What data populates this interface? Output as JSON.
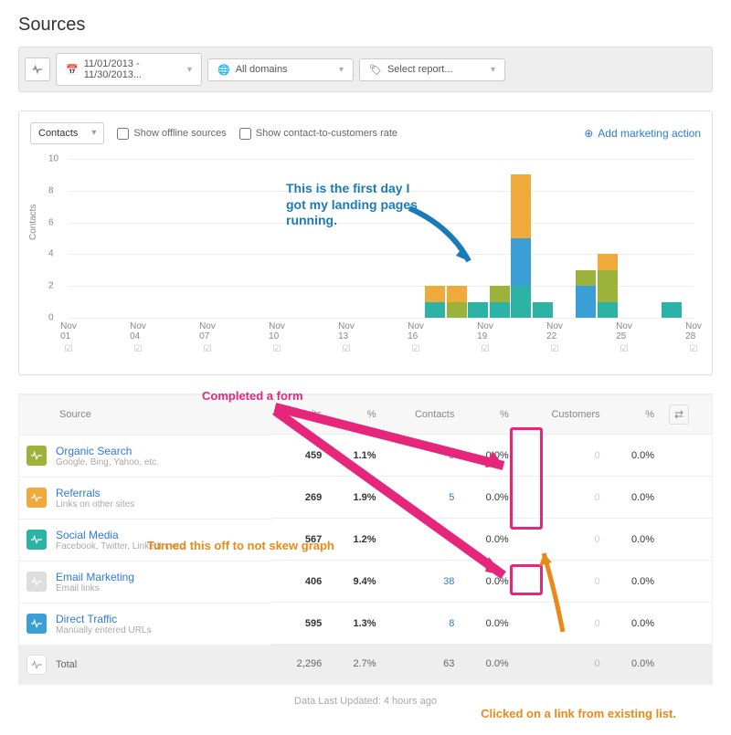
{
  "title": "Sources",
  "toolbar": {
    "date_range": "11/01/2013 - 11/30/2013...",
    "domains": "All domains",
    "report": "Select report..."
  },
  "panel": {
    "metric": "Contacts",
    "show_offline": "Show offline sources",
    "show_c2c": "Show contact-to-customers rate",
    "add_action": "Add marketing action"
  },
  "chart_data": {
    "type": "bar",
    "ylabel": "Contacts",
    "ylim": [
      0,
      10
    ],
    "yticks": [
      0,
      2,
      4,
      6,
      8,
      10
    ],
    "x_ticks": [
      "Nov\n01",
      "Nov\n04",
      "Nov\n07",
      "Nov\n10",
      "Nov\n13",
      "Nov\n16",
      "Nov\n19",
      "Nov\n22",
      "Nov\n25",
      "Nov\n28"
    ],
    "series_colors": {
      "a": "#2db3a5",
      "b": "#9bb23b",
      "c": "#f0a93b",
      "d": "#3b9fd6"
    },
    "stacks": {
      "18": [
        {
          "c": "a",
          "v": 1
        },
        {
          "c": "c",
          "v": 1
        }
      ],
      "19": [
        {
          "c": "b",
          "v": 1
        },
        {
          "c": "c",
          "v": 1
        }
      ],
      "20": [
        {
          "c": "a",
          "v": 1
        }
      ],
      "21": [
        {
          "c": "a",
          "v": 1
        },
        {
          "c": "b",
          "v": 1
        }
      ],
      "22": [
        {
          "c": "a",
          "v": 2
        },
        {
          "c": "d",
          "v": 3
        },
        {
          "c": "c",
          "v": 4
        }
      ],
      "23": [
        {
          "c": "a",
          "v": 1
        }
      ],
      "25": [
        {
          "c": "d",
          "v": 2
        },
        {
          "c": "b",
          "v": 1
        }
      ],
      "26": [
        {
          "c": "a",
          "v": 1
        },
        {
          "c": "b",
          "v": 2
        },
        {
          "c": "c",
          "v": 1
        }
      ],
      "29": [
        {
          "c": "a",
          "v": 1
        }
      ]
    }
  },
  "annotations": {
    "blue": "This is the first day I got my landing pages running.",
    "pink": "Completed a form",
    "orange1": "Turned this off to not skew graph",
    "orange2": "Clicked on a link from existing list."
  },
  "table": {
    "cols": [
      "Source",
      "Visits",
      "%",
      "Contacts",
      "%",
      "Customers",
      "%"
    ],
    "rows": [
      {
        "icon": "#9bb23b",
        "name": "Organic Search",
        "sub": "Google, Bing, Yahoo, etc.",
        "visits": "459",
        "vp": "1.1%",
        "contacts": "5",
        "cp": "0.0%",
        "cust": "0",
        "cup": "0.0%"
      },
      {
        "icon": "#f0a93b",
        "name": "Referrals",
        "sub": "Links on other sites",
        "visits": "269",
        "vp": "1.9%",
        "contacts": "5",
        "cp": "0.0%",
        "cust": "0",
        "cup": "0.0%"
      },
      {
        "icon": "#2db3a5",
        "name": "Social Media",
        "sub": "Facebook, Twitter, LinkedIn, etc.",
        "visits": "567",
        "vp": "1.2%",
        "contacts": "7",
        "cp": "0.0%",
        "cust": "0",
        "cup": "0.0%"
      },
      {
        "icon": "#ddd",
        "name": "Email Marketing",
        "sub": "Email links",
        "visits": "406",
        "vp": "9.4%",
        "contacts": "38",
        "cp": "0.0%",
        "cust": "0",
        "cup": "0.0%"
      },
      {
        "icon": "#3b9fd6",
        "name": "Direct Traffic",
        "sub": "Manually entered URLs",
        "visits": "595",
        "vp": "1.3%",
        "contacts": "8",
        "cp": "0.0%",
        "cust": "0",
        "cup": "0.0%"
      }
    ],
    "total": {
      "label": "Total",
      "visits": "2,296",
      "vp": "2.7%",
      "contacts": "63",
      "cp": "0.0%",
      "cust": "0",
      "cup": "0.0%"
    }
  },
  "footer": "Data Last Updated: 4 hours ago"
}
